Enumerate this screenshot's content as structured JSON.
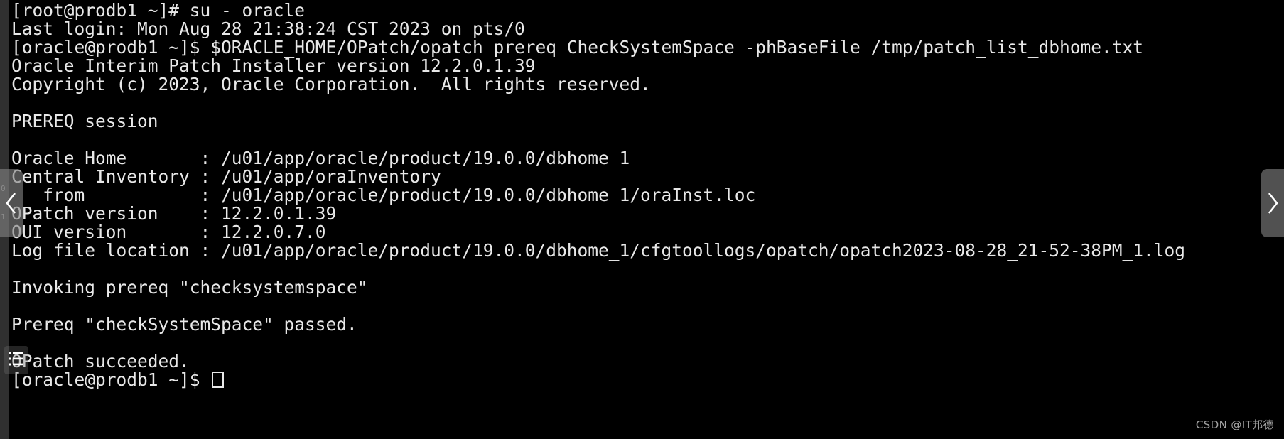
{
  "terminal": {
    "background_color": "#000000",
    "text_color": "#e8e8e8",
    "lines": [
      "[root@prodb1 ~]# su - oracle",
      "Last login: Mon Aug 28 21:38:24 CST 2023 on pts/0",
      "[oracle@prodb1 ~]$ $ORACLE_HOME/OPatch/opatch prereq CheckSystemSpace -phBaseFile /tmp/patch_list_dbhome.txt",
      "Oracle Interim Patch Installer version 12.2.0.1.39",
      "Copyright (c) 2023, Oracle Corporation.  All rights reserved.",
      "",
      "PREREQ session",
      "",
      "Oracle Home       : /u01/app/oracle/product/19.0.0/dbhome_1",
      "Central Inventory : /u01/app/oraInventory",
      "   from           : /u01/app/oracle/product/19.0.0/dbhome_1/oraInst.loc",
      "OPatch version    : 12.2.0.1.39",
      "OUI version       : 12.2.0.7.0",
      "Log file location : /u01/app/oracle/product/19.0.0/dbhome_1/cfgtoollogs/opatch/opatch2023-08-28_21-52-38PM_1.log",
      "",
      "Invoking prereq \"checksystemspace\"",
      "",
      "Prereq \"checkSystemSpace\" passed.",
      "",
      "OPatch succeeded.",
      "[oracle@prodb1 ~]$ "
    ],
    "prompt_root": "[root@prodb1 ~]#",
    "prompt_oracle": "[oracle@prodb1 ~]$",
    "command": "$ORACLE_HOME/OPatch/opatch prereq CheckSystemSpace -phBaseFile /tmp/patch_list_dbhome.txt",
    "host": "prodb1",
    "users": [
      "root",
      "oracle"
    ]
  },
  "session_info": {
    "oracle_home_label": "Oracle Home",
    "oracle_home_value": "/u01/app/oracle/product/19.0.0/dbhome_1",
    "central_inventory_label": "Central Inventory",
    "central_inventory_value": "/u01/app/oraInventory",
    "from_label": "from",
    "from_value": "/u01/app/oracle/product/19.0.0/dbhome_1/oraInst.loc",
    "opatch_version_label": "OPatch version",
    "opatch_version_value": "12.2.0.1.39",
    "oui_version_label": "OUI version",
    "oui_version_value": "12.2.0.7.0",
    "log_file_label": "Log file location",
    "log_file_value": "/u01/app/oracle/product/19.0.0/dbhome_1/cfgtoollogs/opatch/opatch2023-08-28_21-52-38PM_1.log",
    "installer_version": "12.2.0.1.39",
    "copyright": "Copyright (c) 2023, Oracle Corporation.  All rights reserved.",
    "session_type": "PREREQ session",
    "prereq_invoked": "checksystemspace",
    "prereq_result": "Prereq \"checkSystemSpace\" passed.",
    "final_status": "OPatch succeeded.",
    "login_line": "Last login: Mon Aug 28 21:38:24 CST 2023 on pts/0"
  },
  "overlays": {
    "prev_icon": "chevron-left-icon",
    "next_icon": "chevron-right-icon",
    "menu_icon": "list-menu-icon",
    "overlay_color": "#828282"
  },
  "gutter": {
    "numbers": [
      "0",
      "1"
    ]
  },
  "watermark": {
    "text": "CSDN @IT邦德"
  }
}
